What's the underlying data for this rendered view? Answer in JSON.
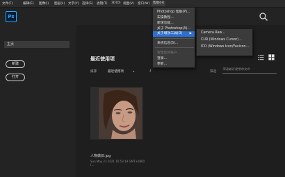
{
  "menubar": {
    "items": [
      {
        "label": "文件(F)"
      },
      {
        "label": "编辑(E)"
      },
      {
        "label": "图像(I)"
      },
      {
        "label": "图层(L)"
      },
      {
        "label": "文字(Y)"
      },
      {
        "label": "选择(S)"
      },
      {
        "label": "滤镜(T)"
      },
      {
        "label": "3D(D)"
      },
      {
        "label": "视图(V)"
      },
      {
        "label": "窗口(W)"
      },
      {
        "label": "帮助(H)"
      }
    ]
  },
  "logo": "Ps",
  "search": {
    "icon": "search-icon"
  },
  "sidebar": {
    "home_label": "主页",
    "new_button": "新建",
    "open_button": "打开"
  },
  "main": {
    "title": "最近使用项",
    "sort_label": "排序",
    "sort_value": "最近使用项",
    "filter_label": "筛选",
    "filter_placeholder": "筛选最近使用的文件"
  },
  "file": {
    "name": "人物做旧.jpg",
    "date": "Sun May 23 2021 16:53:19 GMT+0800 (..."
  },
  "help_menu": {
    "items": [
      {
        "label": "Photoshop 帮助(P)..."
      },
      {
        "label": "实操教程..."
      },
      {
        "label": "新增功能..."
      },
      {
        "label": "关于 Photoshop(A)..."
      },
      {
        "label": "关于增效工具(O)"
      },
      {
        "label": "系统信息(S)..."
      },
      {
        "label": "管理您的帐户..."
      },
      {
        "label": "登录..."
      },
      {
        "label": "更新..."
      }
    ]
  },
  "plugins_submenu": {
    "items": [
      {
        "label": "Camera Raw..."
      },
      {
        "label": "CUR (Windows Cursor)..."
      },
      {
        "label": "ICO (Windows Icon/Favicon..."
      }
    ]
  },
  "colors": {
    "highlight": "#2c6fcf",
    "brand": "#31a8ff"
  }
}
